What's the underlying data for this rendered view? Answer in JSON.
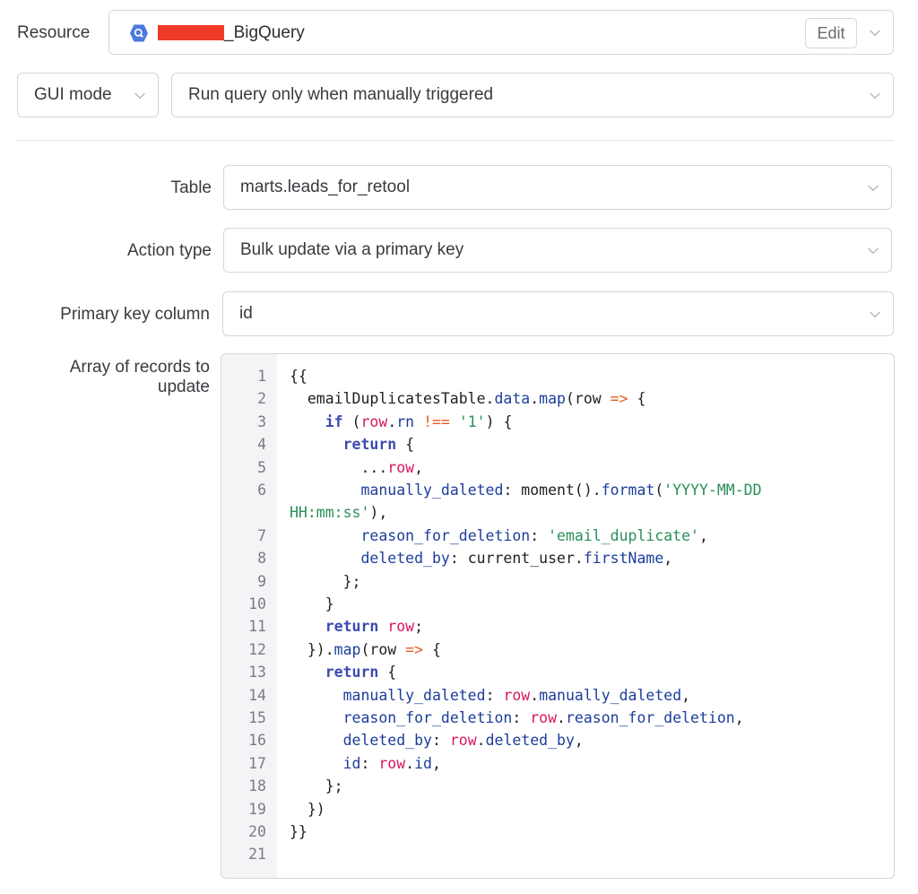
{
  "resource": {
    "label": "Resource",
    "name_suffix": "_BigQuery",
    "edit_label": "Edit",
    "icon": "bigquery-icon"
  },
  "mode": {
    "selected": "GUI mode",
    "trigger": "Run query only when manually triggered"
  },
  "form": {
    "table_label": "Table",
    "table_value": "marts.leads_for_retool",
    "action_label": "Action type",
    "action_value": "Bulk update via a primary key",
    "pk_label": "Primary key column",
    "pk_value": "id",
    "records_label_1": "Array of records to",
    "records_label_2": "update"
  },
  "editor": {
    "line_numbers": [
      "1",
      "2",
      "3",
      "4",
      "5",
      "6",
      "",
      "7",
      "8",
      "9",
      "10",
      "11",
      "12",
      "13",
      "14",
      "15",
      "16",
      "17",
      "18",
      "19",
      "20",
      "21"
    ],
    "lines": [
      [
        [
          "p",
          "{{"
        ]
      ],
      [
        [
          "p",
          "  emailDuplicatesTable."
        ],
        [
          "prop",
          "data"
        ],
        [
          "p",
          "."
        ],
        [
          "fn",
          "map"
        ],
        [
          "p",
          "(row "
        ],
        [
          "op",
          "=>"
        ],
        [
          "p",
          " {"
        ]
      ],
      [
        [
          "p",
          "    "
        ],
        [
          "kw",
          "if"
        ],
        [
          "p",
          " ("
        ],
        [
          "var",
          "row"
        ],
        [
          "p",
          "."
        ],
        [
          "prop",
          "rn"
        ],
        [
          "p",
          " "
        ],
        [
          "op",
          "!=="
        ],
        [
          "p",
          " "
        ],
        [
          "str",
          "'1'"
        ],
        [
          "p",
          ") {"
        ]
      ],
      [
        [
          "p",
          "      "
        ],
        [
          "kw",
          "return"
        ],
        [
          "p",
          " {"
        ]
      ],
      [
        [
          "p",
          "        ..."
        ],
        [
          "var",
          "row"
        ],
        [
          "p",
          ","
        ]
      ],
      [
        [
          "p",
          "        "
        ],
        [
          "prop",
          "manually_daleted"
        ],
        [
          "p",
          ": moment()."
        ],
        [
          "fn",
          "format"
        ],
        [
          "p",
          "("
        ],
        [
          "str",
          "'YYYY-MM-DD"
        ]
      ],
      [
        [
          "str",
          "HH:mm:ss'"
        ],
        [
          "p",
          "),"
        ]
      ],
      [
        [
          "p",
          "        "
        ],
        [
          "prop",
          "reason_for_deletion"
        ],
        [
          "p",
          ": "
        ],
        [
          "str",
          "'email_duplicate'"
        ],
        [
          "p",
          ","
        ]
      ],
      [
        [
          "p",
          "        "
        ],
        [
          "prop",
          "deleted_by"
        ],
        [
          "p",
          ": current_user."
        ],
        [
          "prop",
          "firstName"
        ],
        [
          "p",
          ","
        ]
      ],
      [
        [
          "p",
          "      };"
        ]
      ],
      [
        [
          "p",
          "    }"
        ]
      ],
      [
        [
          "p",
          "    "
        ],
        [
          "kw",
          "return"
        ],
        [
          "p",
          " "
        ],
        [
          "var",
          "row"
        ],
        [
          "p",
          ";"
        ]
      ],
      [
        [
          "p",
          "  })."
        ],
        [
          "fn",
          "map"
        ],
        [
          "p",
          "(row "
        ],
        [
          "op",
          "=>"
        ],
        [
          "p",
          " {"
        ]
      ],
      [
        [
          "p",
          "    "
        ],
        [
          "kw",
          "return"
        ],
        [
          "p",
          " {"
        ]
      ],
      [
        [
          "p",
          "      "
        ],
        [
          "prop",
          "manually_daleted"
        ],
        [
          "p",
          ": "
        ],
        [
          "var",
          "row"
        ],
        [
          "p",
          "."
        ],
        [
          "prop",
          "manually_daleted"
        ],
        [
          "p",
          ","
        ]
      ],
      [
        [
          "p",
          "      "
        ],
        [
          "prop",
          "reason_for_deletion"
        ],
        [
          "p",
          ": "
        ],
        [
          "var",
          "row"
        ],
        [
          "p",
          "."
        ],
        [
          "prop",
          "reason_for_deletion"
        ],
        [
          "p",
          ","
        ]
      ],
      [
        [
          "p",
          "      "
        ],
        [
          "prop",
          "deleted_by"
        ],
        [
          "p",
          ": "
        ],
        [
          "var",
          "row"
        ],
        [
          "p",
          "."
        ],
        [
          "prop",
          "deleted_by"
        ],
        [
          "p",
          ","
        ]
      ],
      [
        [
          "p",
          "      "
        ],
        [
          "prop",
          "id"
        ],
        [
          "p",
          ": "
        ],
        [
          "var",
          "row"
        ],
        [
          "p",
          "."
        ],
        [
          "prop",
          "id"
        ],
        [
          "p",
          ","
        ]
      ],
      [
        [
          "p",
          "    };"
        ]
      ],
      [
        [
          "p",
          "  })"
        ]
      ],
      [
        [
          "p",
          "}}"
        ]
      ],
      [
        [
          "p",
          ""
        ]
      ]
    ]
  }
}
